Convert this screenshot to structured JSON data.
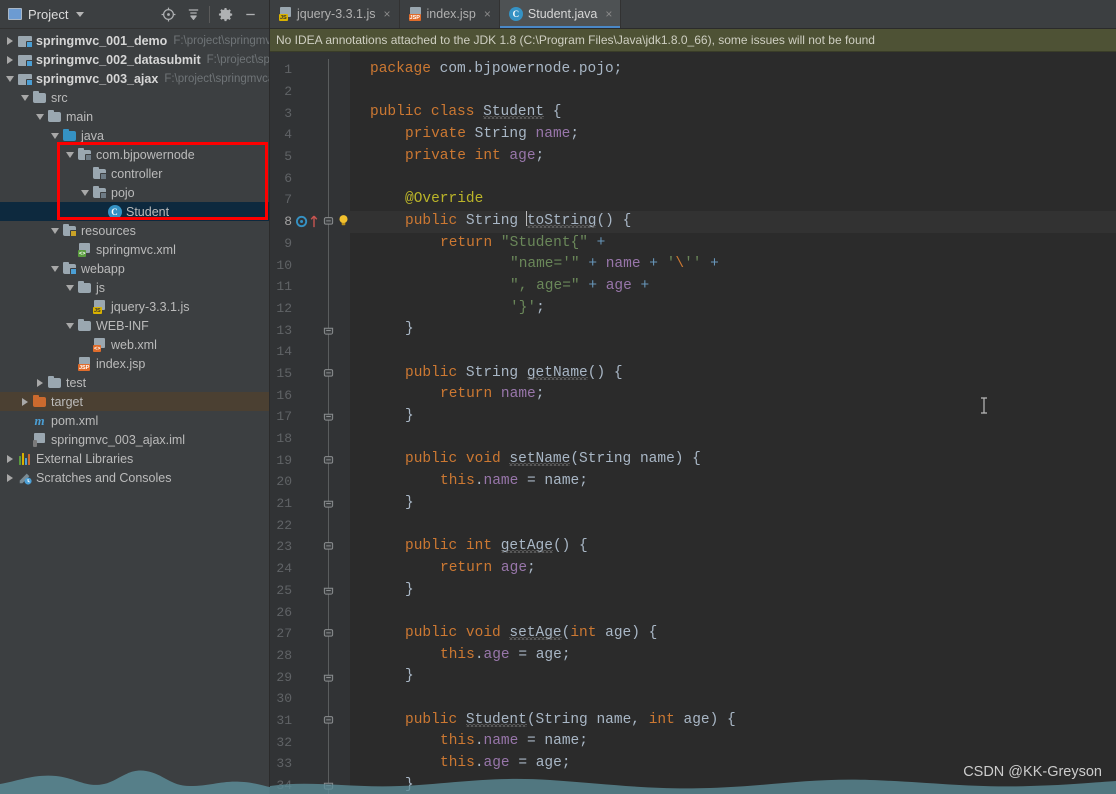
{
  "panel": {
    "title": "Project",
    "icons": {
      "project": "project-icon",
      "dropdown": "chevron-down-icon",
      "locate": "locate-target-icon",
      "collapse": "collapse-all-icon",
      "settings": "gear-icon",
      "hide": "minimize-icon"
    }
  },
  "tree": [
    {
      "label": "springmvc_001_demo",
      "path": "F:\\project\\springmv",
      "indent": 0,
      "arrow": "right",
      "icon": "module",
      "bold": true,
      "state": "normal"
    },
    {
      "label": "springmvc_002_datasubmit",
      "path": "F:\\project\\spr",
      "indent": 0,
      "arrow": "right",
      "icon": "module",
      "bold": true,
      "state": "normal"
    },
    {
      "label": "springmvc_003_ajax",
      "path": "F:\\project\\springmvca",
      "indent": 0,
      "arrow": "down",
      "icon": "module",
      "bold": true,
      "state": "normal"
    },
    {
      "label": "src",
      "path": "",
      "indent": 1,
      "arrow": "down",
      "icon": "folder",
      "bold": false,
      "state": "normal"
    },
    {
      "label": "main",
      "path": "",
      "indent": 2,
      "arrow": "down",
      "icon": "folder",
      "bold": false,
      "state": "normal"
    },
    {
      "label": "java",
      "path": "",
      "indent": 3,
      "arrow": "down",
      "icon": "folder-source",
      "bold": false,
      "state": "normal"
    },
    {
      "label": "com.bjpowernode",
      "path": "",
      "indent": 4,
      "arrow": "down",
      "icon": "package",
      "bold": false,
      "state": "normal"
    },
    {
      "label": "controller",
      "path": "",
      "indent": 5,
      "arrow": "none",
      "icon": "package",
      "bold": false,
      "state": "normal"
    },
    {
      "label": "pojo",
      "path": "",
      "indent": 5,
      "arrow": "down",
      "icon": "package",
      "bold": false,
      "state": "normal"
    },
    {
      "label": "Student",
      "path": "",
      "indent": 6,
      "arrow": "none",
      "icon": "java-class",
      "bold": false,
      "state": "selected"
    },
    {
      "label": "resources",
      "path": "",
      "indent": 3,
      "arrow": "down",
      "icon": "folder-resources",
      "bold": false,
      "state": "normal"
    },
    {
      "label": "springmvc.xml",
      "path": "",
      "indent": 4,
      "arrow": "none",
      "icon": "spring-xml",
      "bold": false,
      "state": "normal"
    },
    {
      "label": "webapp",
      "path": "",
      "indent": 3,
      "arrow": "down",
      "icon": "folder-web",
      "bold": false,
      "state": "normal"
    },
    {
      "label": "js",
      "path": "",
      "indent": 4,
      "arrow": "down",
      "icon": "folder",
      "bold": false,
      "state": "normal"
    },
    {
      "label": "jquery-3.3.1.js",
      "path": "",
      "indent": 5,
      "arrow": "none",
      "icon": "js-file",
      "bold": false,
      "state": "normal"
    },
    {
      "label": "WEB-INF",
      "path": "",
      "indent": 4,
      "arrow": "down",
      "icon": "folder",
      "bold": false,
      "state": "normal"
    },
    {
      "label": "web.xml",
      "path": "",
      "indent": 5,
      "arrow": "none",
      "icon": "web-xml",
      "bold": false,
      "state": "normal"
    },
    {
      "label": "index.jsp",
      "path": "",
      "indent": 4,
      "arrow": "none",
      "icon": "jsp-file",
      "bold": false,
      "state": "normal"
    },
    {
      "label": "test",
      "path": "",
      "indent": 2,
      "arrow": "right",
      "icon": "folder",
      "bold": false,
      "state": "normal"
    },
    {
      "label": "target",
      "path": "",
      "indent": 1,
      "arrow": "right",
      "icon": "folder-excluded",
      "bold": false,
      "state": "highlighted"
    },
    {
      "label": "pom.xml",
      "path": "",
      "indent": 1,
      "arrow": "none",
      "icon": "maven-file",
      "bold": false,
      "state": "normal"
    },
    {
      "label": "springmvc_003_ajax.iml",
      "path": "",
      "indent": 1,
      "arrow": "none",
      "icon": "iml-file",
      "bold": false,
      "state": "normal"
    },
    {
      "label": "External Libraries",
      "path": "",
      "indent": 0,
      "arrow": "right",
      "icon": "libraries",
      "bold": false,
      "state": "normal"
    },
    {
      "label": "Scratches and Consoles",
      "path": "",
      "indent": 0,
      "arrow": "right",
      "icon": "scratches",
      "bold": false,
      "state": "normal"
    }
  ],
  "tabs": [
    {
      "label": "jquery-3.3.1.js",
      "icon": "js-file",
      "active": false,
      "close": "×"
    },
    {
      "label": "index.jsp",
      "icon": "jsp-file",
      "active": false,
      "close": "×"
    },
    {
      "label": "Student.java",
      "icon": "java-class",
      "active": true,
      "close": "×"
    }
  ],
  "banner": {
    "text": "No IDEA annotations attached to the JDK 1.8 (C:\\Program Files\\Java\\jdk1.8.0_66), some issues will not be found"
  },
  "editor": {
    "filename": "Student.java",
    "current_line": 8,
    "first_line": 1,
    "last_line": 34,
    "gutter_markers": {
      "line8": [
        "override-method-icon",
        "intention-bulb-icon"
      ]
    },
    "code_lines": [
      {
        "n": 1,
        "tokens": [
          {
            "t": "package ",
            "c": "kw"
          },
          {
            "t": "com.bjpowernode.pojo;",
            "c": "pln"
          }
        ],
        "indent": 0
      },
      {
        "n": 2,
        "tokens": [],
        "indent": 0
      },
      {
        "n": 3,
        "tokens": [
          {
            "t": "public class ",
            "c": "kw"
          },
          {
            "t": "Student",
            "c": "wavy-cls"
          },
          {
            "t": " {",
            "c": "pln"
          }
        ],
        "indent": 0
      },
      {
        "n": 4,
        "tokens": [
          {
            "t": "private ",
            "c": "kw"
          },
          {
            "t": "String ",
            "c": "cls"
          },
          {
            "t": "name",
            "c": "fld"
          },
          {
            "t": ";",
            "c": "pln"
          }
        ],
        "indent": 1
      },
      {
        "n": 5,
        "tokens": [
          {
            "t": "private int ",
            "c": "kw"
          },
          {
            "t": "age",
            "c": "fld"
          },
          {
            "t": ";",
            "c": "pln"
          }
        ],
        "indent": 1
      },
      {
        "n": 6,
        "tokens": [],
        "indent": 0
      },
      {
        "n": 7,
        "tokens": [
          {
            "t": "@Override",
            "c": "anno"
          }
        ],
        "indent": 1
      },
      {
        "n": 8,
        "tokens": [
          {
            "t": "public ",
            "c": "kw"
          },
          {
            "t": "String ",
            "c": "cls"
          },
          {
            "t": "CARET",
            "c": "caret"
          },
          {
            "t": "toString",
            "c": "wavy-mth"
          },
          {
            "t": "() {",
            "c": "pln"
          }
        ],
        "indent": 1
      },
      {
        "n": 9,
        "tokens": [
          {
            "t": "return ",
            "c": "kw"
          },
          {
            "t": "\"Student{\"",
            "c": "str"
          },
          {
            "t": " + ",
            "c": "num"
          }
        ],
        "indent": 2
      },
      {
        "n": 10,
        "tokens": [
          {
            "t": "\"name='\"",
            "c": "str"
          },
          {
            "t": " + ",
            "c": "num"
          },
          {
            "t": "name",
            "c": "fld"
          },
          {
            "t": " + ",
            "c": "num"
          },
          {
            "t": "'",
            "c": "str"
          },
          {
            "t": "\\",
            "c": "esc"
          },
          {
            "t": "''",
            "c": "str"
          },
          {
            "t": " +",
            "c": "num"
          }
        ],
        "indent": 4
      },
      {
        "n": 11,
        "tokens": [
          {
            "t": "\", age=\"",
            "c": "str"
          },
          {
            "t": " + ",
            "c": "num"
          },
          {
            "t": "age",
            "c": "fld"
          },
          {
            "t": " +",
            "c": "num"
          }
        ],
        "indent": 4
      },
      {
        "n": 12,
        "tokens": [
          {
            "t": "'}'",
            "c": "str"
          },
          {
            "t": ";",
            "c": "pln"
          }
        ],
        "indent": 4
      },
      {
        "n": 13,
        "tokens": [
          {
            "t": "}",
            "c": "pln"
          }
        ],
        "indent": 1
      },
      {
        "n": 14,
        "tokens": [],
        "indent": 0
      },
      {
        "n": 15,
        "tokens": [
          {
            "t": "public ",
            "c": "kw"
          },
          {
            "t": "String ",
            "c": "cls"
          },
          {
            "t": "getName",
            "c": "wavy-mth"
          },
          {
            "t": "() {",
            "c": "pln"
          }
        ],
        "indent": 1
      },
      {
        "n": 16,
        "tokens": [
          {
            "t": "return ",
            "c": "kw"
          },
          {
            "t": "name",
            "c": "fld"
          },
          {
            "t": ";",
            "c": "pln"
          }
        ],
        "indent": 2
      },
      {
        "n": 17,
        "tokens": [
          {
            "t": "}",
            "c": "pln"
          }
        ],
        "indent": 1
      },
      {
        "n": 18,
        "tokens": [],
        "indent": 0
      },
      {
        "n": 19,
        "tokens": [
          {
            "t": "public void ",
            "c": "kw"
          },
          {
            "t": "setName",
            "c": "wavy-mth"
          },
          {
            "t": "(",
            "c": "pln"
          },
          {
            "t": "String",
            "c": "cls"
          },
          {
            "t": " name) {",
            "c": "pln"
          }
        ],
        "indent": 1
      },
      {
        "n": 20,
        "tokens": [
          {
            "t": "this",
            "c": "kw"
          },
          {
            "t": ".",
            "c": "pln"
          },
          {
            "t": "name",
            "c": "fld"
          },
          {
            "t": " = name;",
            "c": "pln"
          }
        ],
        "indent": 2
      },
      {
        "n": 21,
        "tokens": [
          {
            "t": "}",
            "c": "pln"
          }
        ],
        "indent": 1
      },
      {
        "n": 22,
        "tokens": [],
        "indent": 0
      },
      {
        "n": 23,
        "tokens": [
          {
            "t": "public int ",
            "c": "kw"
          },
          {
            "t": "getAge",
            "c": "wavy-mth"
          },
          {
            "t": "() {",
            "c": "pln"
          }
        ],
        "indent": 1
      },
      {
        "n": 24,
        "tokens": [
          {
            "t": "return ",
            "c": "kw"
          },
          {
            "t": "age",
            "c": "fld"
          },
          {
            "t": ";",
            "c": "pln"
          }
        ],
        "indent": 2
      },
      {
        "n": 25,
        "tokens": [
          {
            "t": "}",
            "c": "pln"
          }
        ],
        "indent": 1
      },
      {
        "n": 26,
        "tokens": [],
        "indent": 0
      },
      {
        "n": 27,
        "tokens": [
          {
            "t": "public void ",
            "c": "kw"
          },
          {
            "t": "setAge",
            "c": "wavy-mth"
          },
          {
            "t": "(",
            "c": "pln"
          },
          {
            "t": "int",
            "c": "kw"
          },
          {
            "t": " age) {",
            "c": "pln"
          }
        ],
        "indent": 1
      },
      {
        "n": 28,
        "tokens": [
          {
            "t": "this",
            "c": "kw"
          },
          {
            "t": ".",
            "c": "pln"
          },
          {
            "t": "age",
            "c": "fld"
          },
          {
            "t": " = age;",
            "c": "pln"
          }
        ],
        "indent": 2
      },
      {
        "n": 29,
        "tokens": [
          {
            "t": "}",
            "c": "pln"
          }
        ],
        "indent": 1
      },
      {
        "n": 30,
        "tokens": [],
        "indent": 0
      },
      {
        "n": 31,
        "tokens": [
          {
            "t": "public ",
            "c": "kw"
          },
          {
            "t": "Student",
            "c": "wavy-cls"
          },
          {
            "t": "(",
            "c": "pln"
          },
          {
            "t": "String",
            "c": "cls"
          },
          {
            "t": " name, ",
            "c": "pln"
          },
          {
            "t": "int",
            "c": "kw"
          },
          {
            "t": " age) {",
            "c": "pln"
          }
        ],
        "indent": 1
      },
      {
        "n": 32,
        "tokens": [
          {
            "t": "this",
            "c": "kw"
          },
          {
            "t": ".",
            "c": "pln"
          },
          {
            "t": "name",
            "c": "fld"
          },
          {
            "t": " = name;",
            "c": "pln"
          }
        ],
        "indent": 2
      },
      {
        "n": 33,
        "tokens": [
          {
            "t": "this",
            "c": "kw"
          },
          {
            "t": ".",
            "c": "pln"
          },
          {
            "t": "age",
            "c": "fld"
          },
          {
            "t": " = age;",
            "c": "pln"
          }
        ],
        "indent": 2
      },
      {
        "n": 34,
        "tokens": [
          {
            "t": "}",
            "c": "pln"
          }
        ],
        "indent": 1
      }
    ],
    "fold_lines": [
      8,
      13,
      15,
      17,
      19,
      21,
      23,
      25,
      27,
      29,
      31,
      34
    ]
  },
  "annotation": {
    "type": "red-rectangle",
    "color": "#fd0000"
  },
  "watermark": {
    "text": "CSDN @KK-Greyson"
  },
  "colors": {
    "background": "#3c3f41",
    "editor_bg": "#2b2b2b",
    "gutter_bg": "#313335",
    "selection": "#0d293e",
    "banner_bg": "#4e5235",
    "keyword": "#cc7832",
    "string": "#6a8759",
    "field": "#9876aa",
    "number": "#6897bb",
    "annotation": "#bbb529",
    "plain": "#a9b7c6"
  }
}
